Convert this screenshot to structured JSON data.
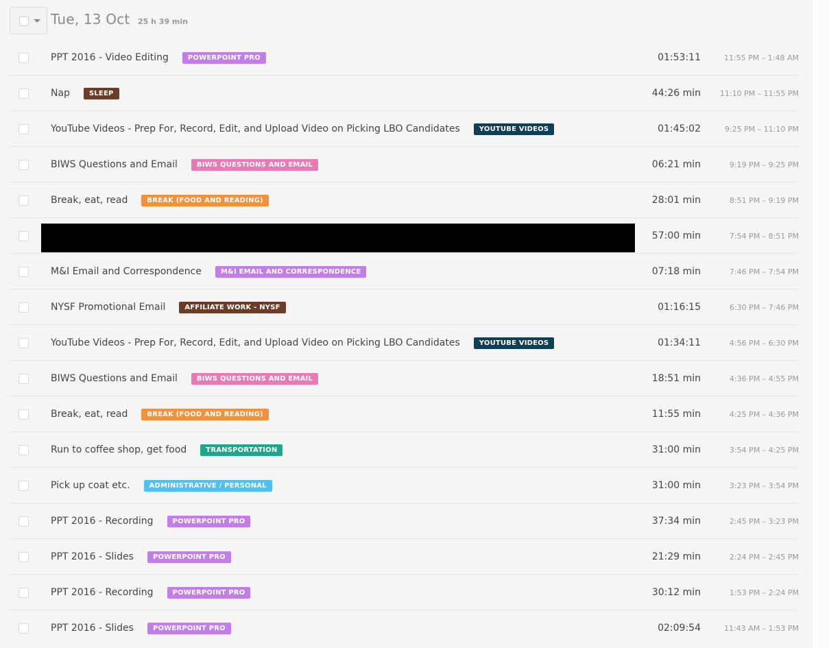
{
  "header": {
    "date": "Tue, 13 Oct",
    "total": "25 h 39 min"
  },
  "entries": [
    {
      "title": "PPT 2016 - Video Editing",
      "tag": "POWERPOINT PRO",
      "tag_color": "#c27ee6",
      "duration": "01:53:11",
      "range": "11:55 PM – 1:48 AM",
      "redacted": false
    },
    {
      "title": "Nap",
      "tag": "SLEEP",
      "tag_color": "#6b3d28",
      "duration": "44:26 min",
      "range": "11:10 PM – 11:55 PM",
      "redacted": false
    },
    {
      "title": "YouTube Videos - Prep For, Record, Edit, and Upload Video on Picking LBO Candidates",
      "tag": "YOUTUBE VIDEOS",
      "tag_color": "#0f3f55",
      "duration": "01:45:02",
      "range": "9:25 PM – 11:10 PM",
      "redacted": false
    },
    {
      "title": "BIWS Questions and Email",
      "tag": "BIWS QUESTIONS AND EMAIL",
      "tag_color": "#e87ab5",
      "duration": "06:21 min",
      "range": "9:19 PM – 9:25 PM",
      "redacted": false
    },
    {
      "title": "Break, eat, read",
      "tag": "BREAK (FOOD AND READING)",
      "tag_color": "#f3913a",
      "duration": "28:01 min",
      "range": "8:51 PM – 9:19 PM",
      "redacted": false
    },
    {
      "title": "",
      "tag": "",
      "tag_color": "",
      "duration": "57:00 min",
      "range": "7:54 PM – 8:51 PM",
      "redacted": true
    },
    {
      "title": "M&I Email and Correspondence",
      "tag": "M&I EMAIL AND CORRESPONDENCE",
      "tag_color": "#c27ee6",
      "duration": "07:18 min",
      "range": "7:46 PM – 7:54 PM",
      "redacted": false
    },
    {
      "title": "NYSF Promotional Email",
      "tag": "AFFILIATE WORK - NYSF",
      "tag_color": "#6b3d28",
      "duration": "01:16:15",
      "range": "6:30 PM – 7:46 PM",
      "redacted": false
    },
    {
      "title": "YouTube Videos - Prep For, Record, Edit, and Upload Video on Picking LBO Candidates",
      "tag": "YOUTUBE VIDEOS",
      "tag_color": "#0f3f55",
      "duration": "01:34:11",
      "range": "4:56 PM – 6:30 PM",
      "redacted": false
    },
    {
      "title": "BIWS Questions and Email",
      "tag": "BIWS QUESTIONS AND EMAIL",
      "tag_color": "#e87ab5",
      "duration": "18:51 min",
      "range": "4:36 PM – 4:55 PM",
      "redacted": false
    },
    {
      "title": "Break, eat, read",
      "tag": "BREAK (FOOD AND READING)",
      "tag_color": "#f3913a",
      "duration": "11:55 min",
      "range": "4:25 PM – 4:36 PM",
      "redacted": false
    },
    {
      "title": "Run to coffee shop, get food",
      "tag": "TRANSPORTATION",
      "tag_color": "#1ea58a",
      "duration": "31:00 min",
      "range": "3:54 PM – 4:25 PM",
      "redacted": false
    },
    {
      "title": "Pick up coat etc.",
      "tag": "ADMINISTRATIVE / PERSONAL",
      "tag_color": "#4fc0f0",
      "duration": "31:00 min",
      "range": "3:23 PM – 3:54 PM",
      "redacted": false
    },
    {
      "title": "PPT 2016 - Recording",
      "tag": "POWERPOINT PRO",
      "tag_color": "#c27ee6",
      "duration": "37:34 min",
      "range": "2:45 PM – 3:23 PM",
      "redacted": false
    },
    {
      "title": "PPT 2016 - Slides",
      "tag": "POWERPOINT PRO",
      "tag_color": "#c27ee6",
      "duration": "21:29 min",
      "range": "2:24 PM – 2:45 PM",
      "redacted": false
    },
    {
      "title": "PPT 2016 - Recording",
      "tag": "POWERPOINT PRO",
      "tag_color": "#c27ee6",
      "duration": "30:12 min",
      "range": "1:53 PM – 2:24 PM",
      "redacted": false
    },
    {
      "title": "PPT 2016 - Slides",
      "tag": "POWERPOINT PRO",
      "tag_color": "#c27ee6",
      "duration": "02:09:54",
      "range": "11:43 AM – 1:53 PM",
      "redacted": false
    }
  ]
}
